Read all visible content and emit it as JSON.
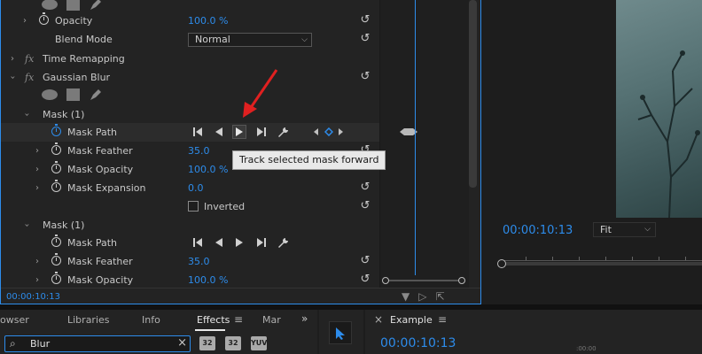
{
  "effect_controls": {
    "rows": [
      {
        "id": "opacity",
        "label": "Opacity",
        "value": "100.0 %"
      },
      {
        "id": "blend",
        "label": "Blend Mode",
        "value": "Normal"
      },
      {
        "id": "time_remap",
        "label": "Time Remapping"
      },
      {
        "id": "gaussian",
        "label": "Gaussian Blur"
      },
      {
        "id": "mask1",
        "label": "Mask (1)"
      },
      {
        "id": "mask_path",
        "label": "Mask Path"
      },
      {
        "id": "mask_feather",
        "label": "Mask Feather",
        "value": "35.0"
      },
      {
        "id": "mask_opacity",
        "label": "Mask Opacity",
        "value": "100.0 %"
      },
      {
        "id": "mask_expansion",
        "label": "Mask Expansion",
        "value": "0.0"
      },
      {
        "id": "inverted",
        "label": "Inverted"
      },
      {
        "id": "mask1b",
        "label": "Mask (1)"
      },
      {
        "id": "mask_path2",
        "label": "Mask Path"
      },
      {
        "id": "mask_feather2",
        "label": "Mask Feather",
        "value": "35.0"
      },
      {
        "id": "mask_opacity2",
        "label": "Mask Opacity",
        "value": "100.0 %"
      }
    ],
    "timecode": "00:00:10:13",
    "tooltip": "Track selected mask forward"
  },
  "program_monitor": {
    "timecode": "00:00:10:13",
    "zoom": "Fit"
  },
  "effects_panel": {
    "tabs": [
      "owser",
      "Libraries",
      "Info",
      "Effects",
      "Mar"
    ],
    "active_tab": "Effects",
    "search_value": "Blur",
    "buttons": [
      "32",
      "32",
      "YUV"
    ]
  },
  "timeline": {
    "title": "Example",
    "timecode": "00:00:10:13",
    "mini_time": ":00:00"
  },
  "colors": {
    "accent": "#2d8ceb",
    "arrow": "#e02020"
  }
}
